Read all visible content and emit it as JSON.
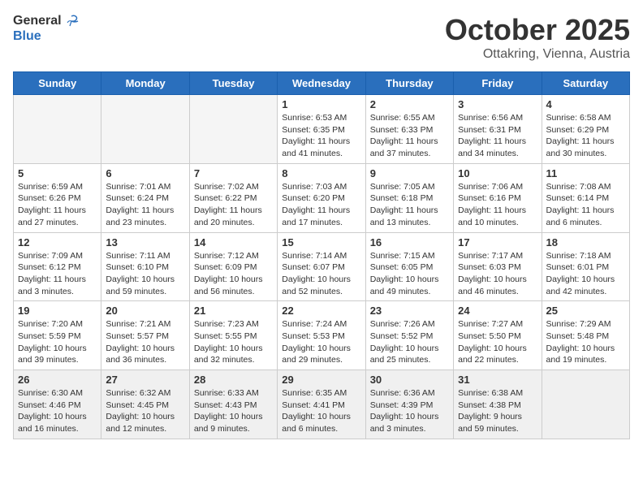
{
  "logo": {
    "general": "General",
    "blue": "Blue"
  },
  "header": {
    "month": "October 2025",
    "location": "Ottakring, Vienna, Austria"
  },
  "weekdays": [
    "Sunday",
    "Monday",
    "Tuesday",
    "Wednesday",
    "Thursday",
    "Friday",
    "Saturday"
  ],
  "weeks": [
    [
      {
        "day": "",
        "info": ""
      },
      {
        "day": "",
        "info": ""
      },
      {
        "day": "",
        "info": ""
      },
      {
        "day": "1",
        "info": "Sunrise: 6:53 AM\nSunset: 6:35 PM\nDaylight: 11 hours\nand 41 minutes."
      },
      {
        "day": "2",
        "info": "Sunrise: 6:55 AM\nSunset: 6:33 PM\nDaylight: 11 hours\nand 37 minutes."
      },
      {
        "day": "3",
        "info": "Sunrise: 6:56 AM\nSunset: 6:31 PM\nDaylight: 11 hours\nand 34 minutes."
      },
      {
        "day": "4",
        "info": "Sunrise: 6:58 AM\nSunset: 6:29 PM\nDaylight: 11 hours\nand 30 minutes."
      }
    ],
    [
      {
        "day": "5",
        "info": "Sunrise: 6:59 AM\nSunset: 6:26 PM\nDaylight: 11 hours\nand 27 minutes."
      },
      {
        "day": "6",
        "info": "Sunrise: 7:01 AM\nSunset: 6:24 PM\nDaylight: 11 hours\nand 23 minutes."
      },
      {
        "day": "7",
        "info": "Sunrise: 7:02 AM\nSunset: 6:22 PM\nDaylight: 11 hours\nand 20 minutes."
      },
      {
        "day": "8",
        "info": "Sunrise: 7:03 AM\nSunset: 6:20 PM\nDaylight: 11 hours\nand 17 minutes."
      },
      {
        "day": "9",
        "info": "Sunrise: 7:05 AM\nSunset: 6:18 PM\nDaylight: 11 hours\nand 13 minutes."
      },
      {
        "day": "10",
        "info": "Sunrise: 7:06 AM\nSunset: 6:16 PM\nDaylight: 11 hours\nand 10 minutes."
      },
      {
        "day": "11",
        "info": "Sunrise: 7:08 AM\nSunset: 6:14 PM\nDaylight: 11 hours\nand 6 minutes."
      }
    ],
    [
      {
        "day": "12",
        "info": "Sunrise: 7:09 AM\nSunset: 6:12 PM\nDaylight: 11 hours\nand 3 minutes."
      },
      {
        "day": "13",
        "info": "Sunrise: 7:11 AM\nSunset: 6:10 PM\nDaylight: 10 hours\nand 59 minutes."
      },
      {
        "day": "14",
        "info": "Sunrise: 7:12 AM\nSunset: 6:09 PM\nDaylight: 10 hours\nand 56 minutes."
      },
      {
        "day": "15",
        "info": "Sunrise: 7:14 AM\nSunset: 6:07 PM\nDaylight: 10 hours\nand 52 minutes."
      },
      {
        "day": "16",
        "info": "Sunrise: 7:15 AM\nSunset: 6:05 PM\nDaylight: 10 hours\nand 49 minutes."
      },
      {
        "day": "17",
        "info": "Sunrise: 7:17 AM\nSunset: 6:03 PM\nDaylight: 10 hours\nand 46 minutes."
      },
      {
        "day": "18",
        "info": "Sunrise: 7:18 AM\nSunset: 6:01 PM\nDaylight: 10 hours\nand 42 minutes."
      }
    ],
    [
      {
        "day": "19",
        "info": "Sunrise: 7:20 AM\nSunset: 5:59 PM\nDaylight: 10 hours\nand 39 minutes."
      },
      {
        "day": "20",
        "info": "Sunrise: 7:21 AM\nSunset: 5:57 PM\nDaylight: 10 hours\nand 36 minutes."
      },
      {
        "day": "21",
        "info": "Sunrise: 7:23 AM\nSunset: 5:55 PM\nDaylight: 10 hours\nand 32 minutes."
      },
      {
        "day": "22",
        "info": "Sunrise: 7:24 AM\nSunset: 5:53 PM\nDaylight: 10 hours\nand 29 minutes."
      },
      {
        "day": "23",
        "info": "Sunrise: 7:26 AM\nSunset: 5:52 PM\nDaylight: 10 hours\nand 25 minutes."
      },
      {
        "day": "24",
        "info": "Sunrise: 7:27 AM\nSunset: 5:50 PM\nDaylight: 10 hours\nand 22 minutes."
      },
      {
        "day": "25",
        "info": "Sunrise: 7:29 AM\nSunset: 5:48 PM\nDaylight: 10 hours\nand 19 minutes."
      }
    ],
    [
      {
        "day": "26",
        "info": "Sunrise: 6:30 AM\nSunset: 4:46 PM\nDaylight: 10 hours\nand 16 minutes."
      },
      {
        "day": "27",
        "info": "Sunrise: 6:32 AM\nSunset: 4:45 PM\nDaylight: 10 hours\nand 12 minutes."
      },
      {
        "day": "28",
        "info": "Sunrise: 6:33 AM\nSunset: 4:43 PM\nDaylight: 10 hours\nand 9 minutes."
      },
      {
        "day": "29",
        "info": "Sunrise: 6:35 AM\nSunset: 4:41 PM\nDaylight: 10 hours\nand 6 minutes."
      },
      {
        "day": "30",
        "info": "Sunrise: 6:36 AM\nSunset: 4:39 PM\nDaylight: 10 hours\nand 3 minutes."
      },
      {
        "day": "31",
        "info": "Sunrise: 6:38 AM\nSunset: 4:38 PM\nDaylight: 9 hours\nand 59 minutes."
      },
      {
        "day": "",
        "info": ""
      }
    ]
  ]
}
